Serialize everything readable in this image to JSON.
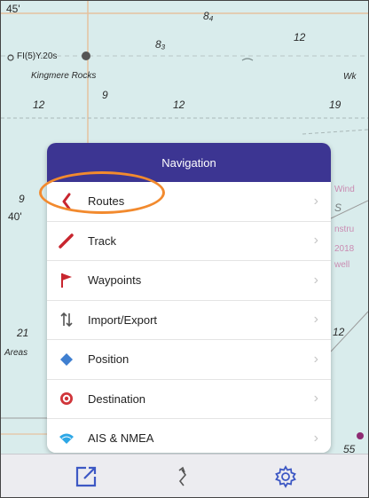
{
  "map": {
    "labels": {
      "lat": "45'",
      "lat2": "40'",
      "s84": "8₄",
      "s83": "8₃",
      "d12a": "12",
      "d12b": "12",
      "d12c": "12",
      "d19": "19",
      "d9a": "9",
      "d9b": "9",
      "d21": "21",
      "d12d": "12",
      "d55": "55",
      "wk": "Wk",
      "light": "FI(5)Y.20s",
      "rocks": "Kingmere Rocks",
      "areas": "Areas",
      "winds": "Wind",
      "constr": "nstru",
      "year": "2018",
      "well": "well",
      "s": "S"
    }
  },
  "navigation": {
    "title": "Navigation",
    "items": [
      {
        "label": "Routes",
        "icon": "route-icon"
      },
      {
        "label": "Track",
        "icon": "track-pencil-icon"
      },
      {
        "label": "Waypoints",
        "icon": "waypoint-flag-icon"
      },
      {
        "label": "Import/Export",
        "icon": "import-export-icon"
      },
      {
        "label": "Position",
        "icon": "position-diamond-icon"
      },
      {
        "label": "Destination",
        "icon": "destination-target-icon"
      },
      {
        "label": "AIS & NMEA",
        "icon": "wifi-icon"
      }
    ],
    "chevron": "›"
  },
  "toolbar": {
    "items": [
      "share-icon",
      "route-arrow-icon",
      "settings-gear-icon"
    ]
  },
  "colors": {
    "header": "#3c3592",
    "highlight": "#f28a2e",
    "toolbar_icon": "#3d58c4",
    "sea": "#d9ecec"
  }
}
